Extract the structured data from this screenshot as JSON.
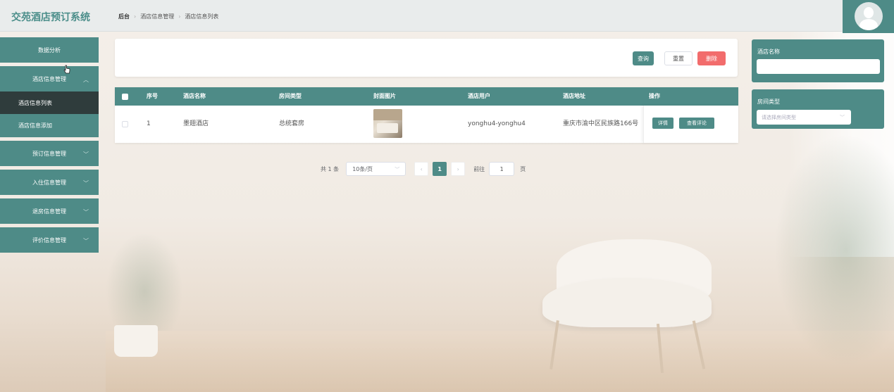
{
  "app": {
    "title": "交苑酒店预订系统"
  },
  "breadcrumb": [
    "后台",
    "酒店信息管理",
    "酒店信息列表"
  ],
  "sidebar": {
    "items": [
      {
        "label": "数据分析",
        "expandable": false
      },
      {
        "label": "酒店信息管理",
        "expandable": true,
        "expanded": true,
        "children": [
          {
            "label": "酒店信息列表",
            "active": true
          },
          {
            "label": "酒店信息添加",
            "active": false
          }
        ]
      },
      {
        "label": "预订信息管理",
        "expandable": true
      },
      {
        "label": "入住信息管理",
        "expandable": true
      },
      {
        "label": "退房信息管理",
        "expandable": true
      },
      {
        "label": "评价信息管理",
        "expandable": true
      }
    ]
  },
  "toolbar": {
    "query_label": "查询",
    "reset_label": "重置",
    "delete_label": "删除"
  },
  "table": {
    "columns": [
      "序号",
      "酒店名称",
      "房间类型",
      "封面图片",
      "酒店用户",
      "酒店地址",
      "操作"
    ],
    "rows": [
      {
        "index": "1",
        "name": "墨翅酒店",
        "room_type": "总统套房",
        "user": "yonghu4-yonghu4",
        "address": "重庆市渝中区民族路166号",
        "actions": [
          "详情",
          "查看评论"
        ]
      }
    ]
  },
  "pagination": {
    "total": "共 1 条",
    "page_size": "10条/页",
    "current_page": "1",
    "goto_label": "前往",
    "goto_value": "1",
    "page_unit": "页"
  },
  "filters": {
    "hotel_name_label": "酒店名称",
    "hotel_name_value": "",
    "room_type_label": "房间类型",
    "room_type_placeholder": "请选择房间类型"
  },
  "colors": {
    "primary": "#4e8b87",
    "danger": "#f26c6c",
    "active_menu": "#2f3c3c"
  }
}
